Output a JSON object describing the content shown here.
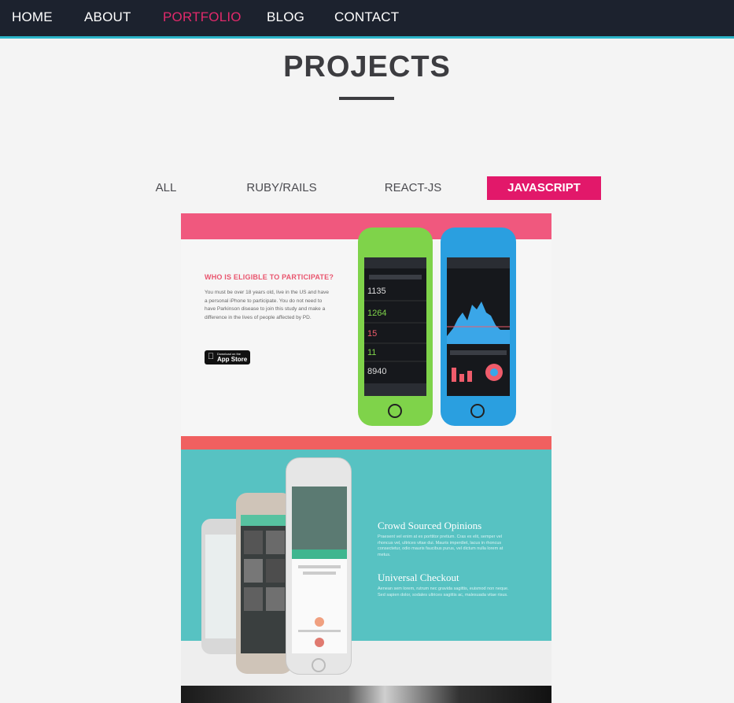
{
  "nav": {
    "items": [
      {
        "label": "HOME",
        "active": false
      },
      {
        "label": "ABOUT",
        "active": false
      },
      {
        "label": "PORTFOLIO",
        "active": true
      },
      {
        "label": "BLOG",
        "active": false
      },
      {
        "label": "CONTACT",
        "active": false
      }
    ]
  },
  "header": {
    "title": "PROJECTS"
  },
  "filters": [
    {
      "label": "ALL",
      "active": false
    },
    {
      "label": "RUBY/RAILS",
      "active": false
    },
    {
      "label": "REACT-JS",
      "active": false
    },
    {
      "label": "JAVASCRIPT",
      "active": true
    }
  ],
  "projects": [
    {
      "heading": "WHO IS ELIGIBLE TO PARTICIPATE?",
      "text": "You must be over 18 years old, live in the US and have a personal iPhone to participate. You do not need to have Parkinson disease to join this study and make a difference in the lives of people affected by PD.",
      "badge_small": "Download on the",
      "badge_big": "App Store"
    },
    {
      "heading_1": "Crowd Sourced Opinions",
      "text_1": "Praesent vel enim at ex porttitor pretium. Cras ex elit, semper vel rhoncus vel, ultrices vitae dui. Mauris imperdiet, lacus in rhoncus consectetur, odio mauris faucibus purus, vel dictum nulla lorem at metus.",
      "heading_2": "Universal Checkout",
      "text_2": "Aenean sem lorem, rutrum nec gravida sagittis, euismod non neque. Sed sapien dolor, sodales ultrices sagittis ac, malesuada vitae risus."
    }
  ],
  "colors": {
    "nav_bg": "#1c222e",
    "nav_accent": "#2bb5c9",
    "brand_pink": "#e2186a",
    "card_pink": "#f0587e",
    "card_teal": "#57c2c2"
  }
}
